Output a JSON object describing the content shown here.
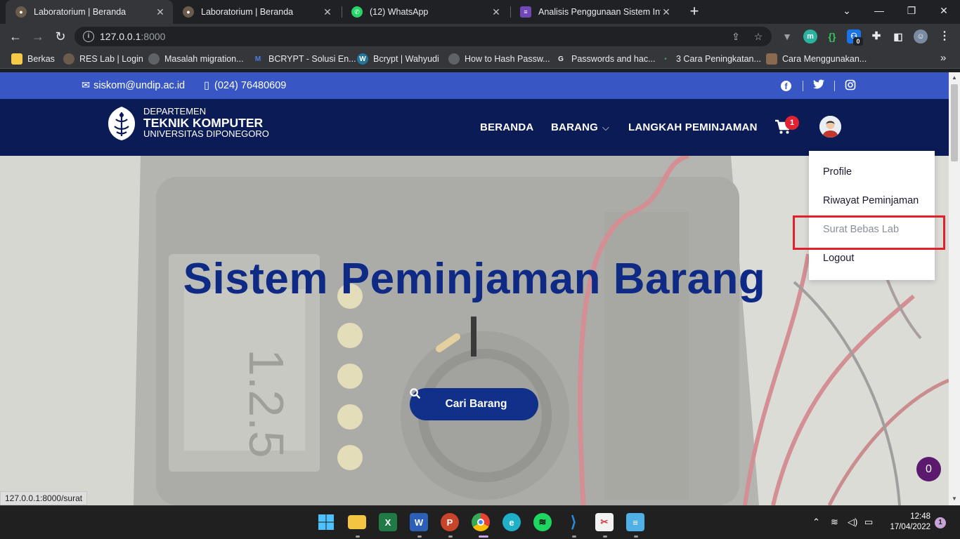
{
  "browser": {
    "tabs": [
      {
        "title": "Laboratorium | Beranda",
        "active": true
      },
      {
        "title": "Laboratorium | Beranda",
        "active": false
      },
      {
        "title": "(12) WhatsApp",
        "active": false
      },
      {
        "title": "Analisis Penggunaan Sistem Infra",
        "active": false
      }
    ],
    "new_tab": "+",
    "url_host": "127.0.0.1",
    "url_port": ":8000",
    "extension_badge": "0",
    "bookmarks": [
      {
        "label": "Berkas"
      },
      {
        "label": "RES Lab | Login"
      },
      {
        "label": "Masalah migration..."
      },
      {
        "label": "BCRYPT - Solusi En..."
      },
      {
        "label": "Bcrypt | Wahyudi"
      },
      {
        "label": "How to Hash Passw..."
      },
      {
        "label": "Passwords and hac..."
      },
      {
        "label": "3 Cara Peningkatan..."
      },
      {
        "label": "Cara Menggunakan..."
      }
    ],
    "more_bookmarks": "»",
    "status_url": "127.0.0.1:8000/surat"
  },
  "site": {
    "topbar": {
      "email": "siskom@undip.ac.id",
      "phone": "(024) 76480609"
    },
    "logo": {
      "line1": "DEPARTEMEN",
      "line2": "TEKNIK KOMPUTER",
      "line3": "UNIVERSITAS DIPONEGORO"
    },
    "nav": {
      "home": "BERANDA",
      "items": "BARANG",
      "steps": "LANGKAH PEMINJAMAN",
      "cart_count": "1"
    },
    "dropdown": {
      "profile": "Profile",
      "history": "Riwayat Peminjaman",
      "letter": "Surat Bebas Lab",
      "logout": "Logout"
    },
    "hero": {
      "title": "Sistem Peminjaman Barang",
      "search_button": "Cari Barang"
    },
    "chat_count": "0"
  },
  "taskbar": {
    "time": "12:48",
    "date": "17/04/2022",
    "notifications": "1"
  },
  "colors": {
    "topbar": "#3857c4",
    "navbar": "#0b1b55",
    "hero_title": "#0e2a85",
    "button": "#10308a",
    "cart_badge": "#e12433",
    "highlight": "#e0202a"
  }
}
